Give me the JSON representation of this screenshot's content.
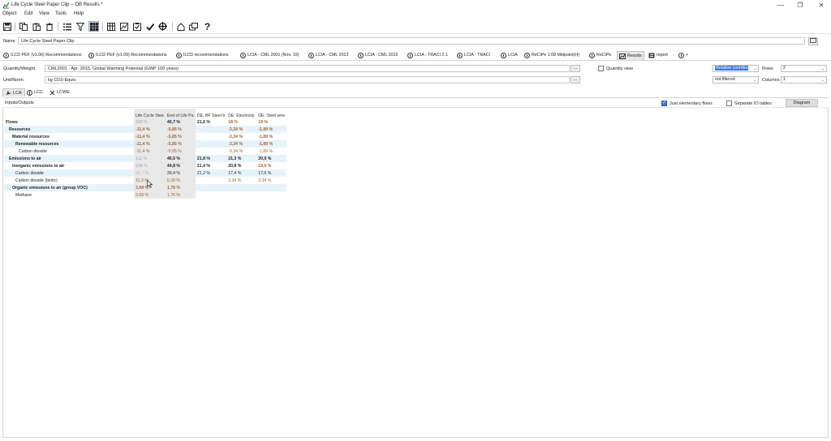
{
  "window": {
    "title": "Life Cycle Steel Paper Clip -- DB Results *",
    "controls": {
      "minimize": "—",
      "restore": "❐",
      "close": "✕"
    }
  },
  "menu": [
    "Object",
    "Edit",
    "View",
    "Tools",
    "Help"
  ],
  "toolbar": {
    "icons": [
      "save-icon",
      "copy-icon",
      "paste-icon",
      "delete-icon",
      "list-icon",
      "filter-icon",
      "grid-icon",
      "columns-icon",
      "chart-icon",
      "checklist-icon",
      "check-icon",
      "target-icon",
      "home-icon",
      "windows-icon",
      "help-icon"
    ],
    "help_label": "?"
  },
  "name_row": {
    "label": "Name",
    "value": "Life Cycle Steel Paper Clip"
  },
  "method_tabs": [
    "ILCD PEF (v1.06) Recommendations",
    "ILCD PEF (v1.09) Recommendations",
    "ILCD recommendations",
    "LCIA - CML 2001 (Nov. 10)",
    "LCIA - CML 2013",
    "LCIA - CML 2015",
    "LCIA - TRACI 2.1",
    "LCIA - TRACI",
    "LCIA",
    "ReCiPe 1.08 Midpoint(H)",
    "ReCiPe",
    "Results",
    "report",
    "+"
  ],
  "quantity": {
    "label": "Quantity/Weight.",
    "value": "CML2001 - Apr. 2015, Global Warming Potential (GWP 100 years)",
    "unit_label": "Unit/Norm.",
    "unit_value": "kg CO2-Equiv.",
    "more": "..."
  },
  "options": {
    "quantity_view": "Quantity view",
    "mode_value": "Relative contribu",
    "filter_value": "not filtered",
    "rows_label": "Rows",
    "rows_value": "2",
    "columns_label": "Columns",
    "columns_value": "1"
  },
  "sub_tabs": [
    "LCA",
    "LCC",
    "LCWE"
  ],
  "panel": {
    "header_label": "Inputs/Outputs",
    "just_elementary": "Just elementary flows",
    "separate_io": "Separate IO tables",
    "diagram": "Diagram"
  },
  "table": {
    "columns": [
      "Life Cycle Stee",
      "End of Life Pa",
      "DE: BF Steel b",
      "DE: Electricity",
      "DE: Steel wire"
    ],
    "rows": [
      {
        "label": "Flows",
        "style": "lv0",
        "values": [
          "100 %",
          "40,7 %",
          "21,6 %",
          "18 %",
          "19 %"
        ]
      },
      {
        "label": "Resources",
        "style": "lv1",
        "values": [
          "-11,4 %",
          "-5,85 %",
          "",
          "-3,34 %",
          "-1,89 %"
        ]
      },
      {
        "label": "Material resources",
        "style": "lv2",
        "values": [
          "-11,4 %",
          "-5,85 %",
          "",
          "-3,34 %",
          "-1,89 %"
        ]
      },
      {
        "label": "Renewable resources",
        "style": "lv3",
        "values": [
          "-11,4 %",
          "-5,85 %",
          "",
          "-3,34 %",
          "-1,89 %"
        ]
      },
      {
        "label": "Carbon dioxide",
        "style": "lv4",
        "values": [
          "-11,4 %",
          "-5,85 %",
          "",
          "-3,34 %",
          "-1,89 %"
        ]
      },
      {
        "label": "Emissions to air",
        "style": "lv1",
        "values": [
          "111 %",
          "46,5 %",
          "21,8 %",
          "21,3 %",
          "20,9 %"
        ]
      },
      {
        "label": "Inorganic emissions to air",
        "style": "lv2",
        "values": [
          "108 %",
          "44,8 %",
          "21,4 %",
          "20,8 %",
          "19,9 %"
        ]
      },
      {
        "label": "Carbon dioxide",
        "style": "lv2n",
        "values": [
          "96,7 %",
          "39,4 %",
          "21,2 %",
          "17,4 %",
          "17,6 %"
        ]
      },
      {
        "label": "Carbon dioxide (biotic)",
        "style": "lv2n",
        "values": [
          "11,3 %",
          "5,38 %",
          "",
          "3,34 %",
          "2,34 %"
        ]
      },
      {
        "label": "Organic emissions to air (group VOC)",
        "style": "lv2",
        "values": [
          "3,68 %",
          "1,76 %",
          "",
          "",
          ""
        ]
      },
      {
        "label": "Methane",
        "style": "lv3n",
        "values": [
          "3,68 %",
          "1,76 %",
          "",
          "",
          ""
        ]
      }
    ]
  }
}
